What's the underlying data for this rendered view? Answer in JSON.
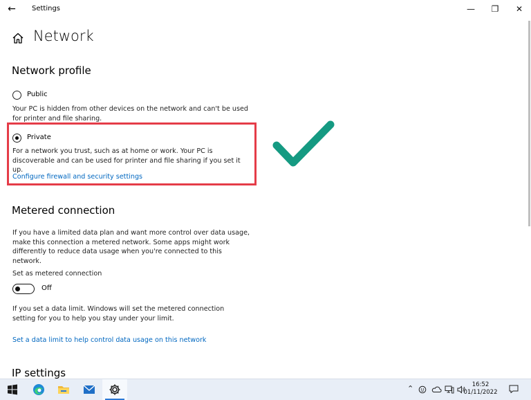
{
  "window": {
    "title": "Settings",
    "back_glyph": "←",
    "minimize_glyph": "—",
    "maximize_glyph": "❐",
    "close_glyph": "✕"
  },
  "page": {
    "title": "Network"
  },
  "network_profile": {
    "heading": "Network profile",
    "options": [
      {
        "label": "Public",
        "selected": false,
        "description": "Your PC is hidden from other devices on the network and can't be used for printer and file sharing."
      },
      {
        "label": "Private",
        "selected": true,
        "description": "For a network you trust, such as at home or work. Your PC is discoverable and can be used for printer and file sharing if you set it up."
      }
    ],
    "firewall_link": "Configure firewall and security settings"
  },
  "metered": {
    "heading": "Metered connection",
    "description": "If you have a limited data plan and want more control over data usage, make this connection a metered network. Some apps might work differently to reduce data usage when you're connected to this network.",
    "toggle_label": "Set as metered connection",
    "toggle_state": "Off",
    "note": "If you set a data limit. Windows will set the metered connection setting for you to help you stay under your limit.",
    "data_limit_link": "Set a data limit to help control data usage on this network"
  },
  "ip_settings": {
    "heading": "IP settings"
  },
  "annotation": {
    "highlight_color": "#e53c48",
    "checkmark_color": "#159a82",
    "checkmark_icon": "checkmark-icon"
  },
  "taskbar": {
    "apps": [
      "windows-start-icon",
      "edge-icon",
      "file-explorer-icon",
      "mail-icon",
      "settings-icon"
    ],
    "tray_glyphs": {
      "chevron": "⌃"
    },
    "time": "16:52",
    "date": "01/11/2022"
  },
  "colors": {
    "accent": "#0067c0",
    "taskbar_bg": "#e8eef7"
  }
}
